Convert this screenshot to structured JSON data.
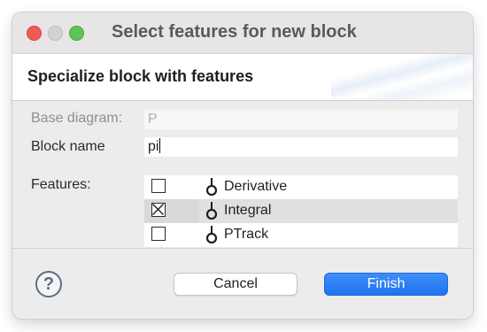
{
  "window": {
    "title": "Select features for new block"
  },
  "banner": {
    "title": "Specialize block with features"
  },
  "form": {
    "base_diagram_label": "Base diagram:",
    "base_diagram_value": "P",
    "block_name_label": "Block name",
    "block_name_value": "pi",
    "features_label": "Features:"
  },
  "features": [
    {
      "name": "Derivative",
      "checked": false,
      "selected": false
    },
    {
      "name": "Integral",
      "checked": true,
      "selected": true
    },
    {
      "name": "PTrack",
      "checked": false,
      "selected": false
    }
  ],
  "footer": {
    "help_glyph": "?",
    "cancel_label": "Cancel",
    "finish_label": "Finish"
  },
  "colors": {
    "accent": "#1f73ee",
    "traffic_close": "#ee5b56",
    "traffic_zoom": "#5fc455"
  },
  "icons": {
    "feature_icon": "lollipop-port-icon",
    "check_mark": "x-check-icon",
    "help": "help-icon"
  }
}
